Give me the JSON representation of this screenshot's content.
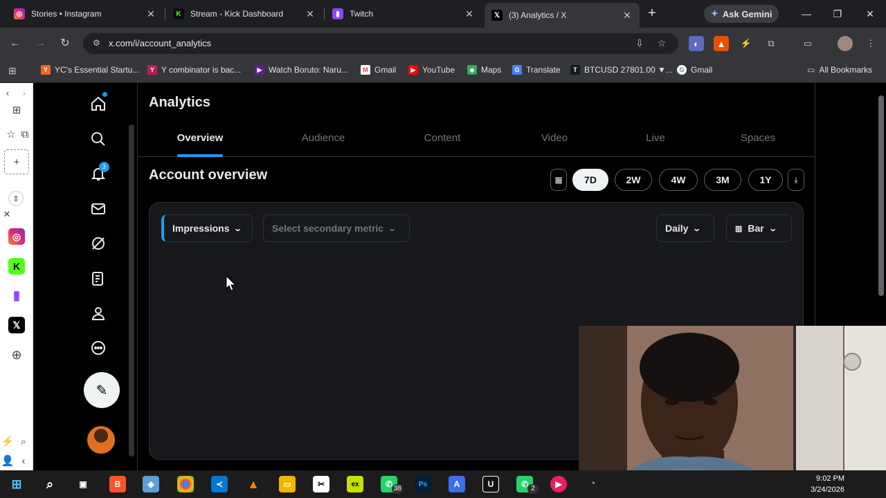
{
  "browser": {
    "tabs": [
      {
        "title": "Stories • Instagram",
        "icon": "instagram-icon",
        "color": "#dd2a7b"
      },
      {
        "title": "Stream - Kick Dashboard",
        "icon": "kick-icon",
        "color": "#53fc18"
      },
      {
        "title": "Twitch",
        "icon": "twitch-icon",
        "color": "#9146ff"
      },
      {
        "title": "(3) Analytics / X",
        "icon": "x-icon",
        "color": "#000000"
      }
    ],
    "gemini_label": "Ask Gemini",
    "url": "x.com/i/account_analytics",
    "bookmarks": [
      {
        "label": "YC's Essential Startu...",
        "icon": "Y",
        "color": "#f26522"
      },
      {
        "label": "Y combinator is bac...",
        "icon": "Y",
        "color": "#c2185b"
      },
      {
        "label": "Watch Boruto: Naru...",
        "icon": "▶",
        "color": "#6a1b9a"
      },
      {
        "label": "Gmail",
        "icon": "M",
        "color": "#ea4335"
      },
      {
        "label": "YouTube",
        "icon": "▶",
        "color": "#ff0000"
      },
      {
        "label": "Maps",
        "icon": "◆",
        "color": "#34a853"
      },
      {
        "label": "Translate",
        "icon": "G",
        "color": "#4285f4"
      },
      {
        "label": "BTCUSD 27801.00 ▼...",
        "icon": "TV",
        "color": "#131722"
      },
      {
        "label": "Gmail",
        "icon": "G",
        "color": "#ffffff"
      }
    ],
    "all_bookmarks": "All Bookmarks"
  },
  "x": {
    "notification_count": "3",
    "page_title": "Analytics",
    "tabs": [
      "Overview",
      "Audience",
      "Content",
      "Video",
      "Live",
      "Spaces"
    ],
    "active_tab": "Overview",
    "section_title": "Account overview",
    "ranges": [
      "7D",
      "2W",
      "4W",
      "3M",
      "1Y"
    ],
    "selected_range": "7D",
    "primary_metric": "Impressions",
    "secondary_metric_placeholder": "Select secondary metric",
    "granularity": "Daily",
    "chart_type": "Bar"
  },
  "taskbar": {
    "whatsapp_badge": "38",
    "whatsapp2_badge": "2",
    "time": "9:02 PM",
    "date": "3/24/2026"
  },
  "colors": {
    "accent": "#1d9bf0",
    "background": "#000000",
    "card": "#16181c"
  }
}
